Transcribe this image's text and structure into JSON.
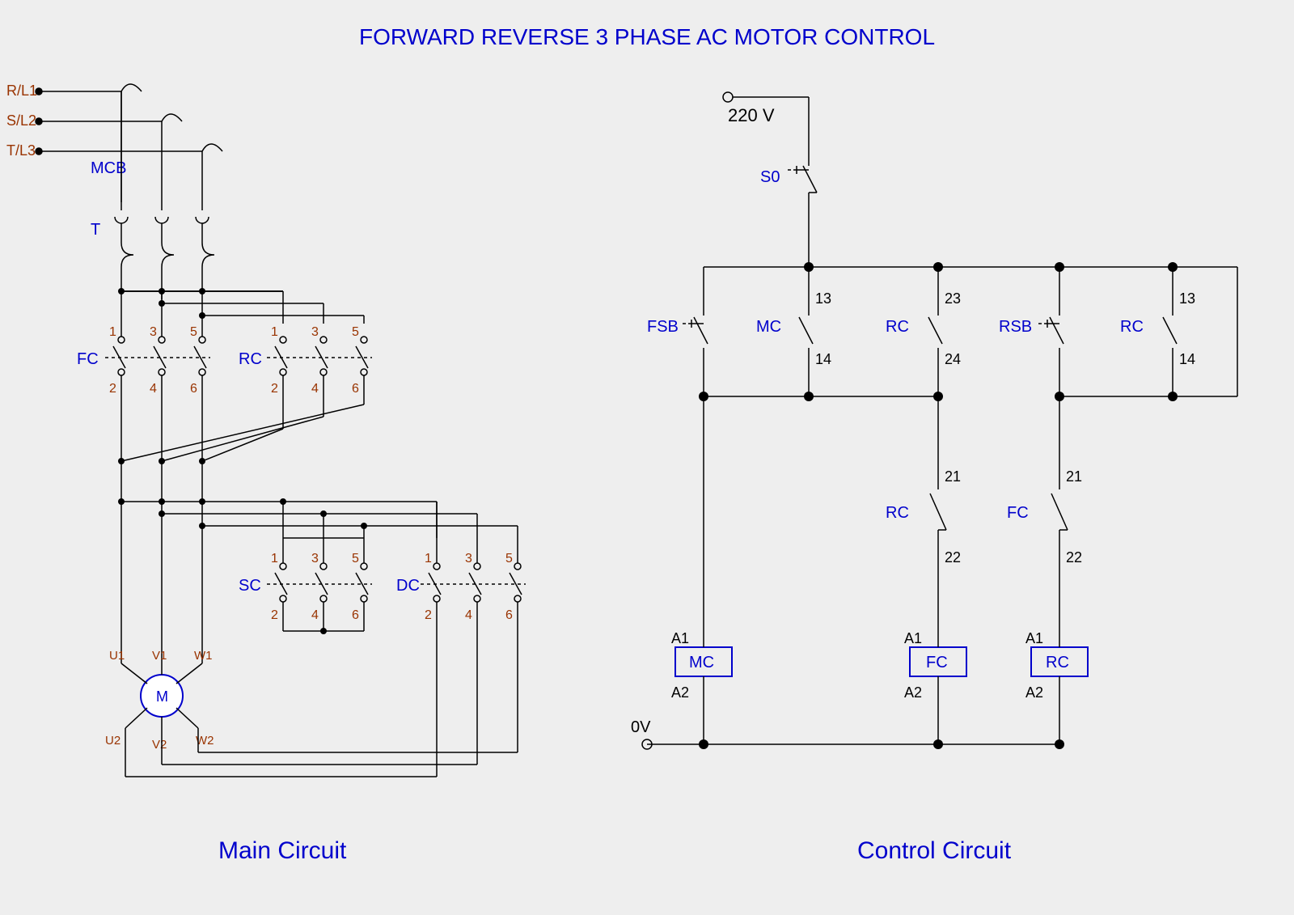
{
  "title": "FORWARD REVERSE 3 PHASE AC MOTOR CONTROL",
  "main_circuit_label": "Main Circuit",
  "control_circuit_label": "Control Circuit",
  "main": {
    "lines": {
      "l1": "R/L1",
      "l2": "S/L2",
      "l3": "T/L3"
    },
    "mcb": "MCB",
    "t": "T",
    "fc": "FC",
    "rc": "RC",
    "sc": "SC",
    "dc": "DC",
    "motor": "M",
    "motor_terms": {
      "u1": "U1",
      "v1": "V1",
      "w1": "W1",
      "u2": "U2",
      "v2": "V2",
      "w2": "W2"
    },
    "nums": {
      "n1": "1",
      "n2": "2",
      "n3": "3",
      "n4": "4",
      "n5": "5",
      "n6": "6"
    }
  },
  "control": {
    "v_top": "220 V",
    "v_bot": "0V",
    "s0": "S0",
    "fsb": "FSB",
    "rsb": "RSB",
    "mc": "MC",
    "rc": "RC",
    "fc": "FC",
    "a1": "A1",
    "a2": "A2",
    "c13": "13",
    "c14": "14",
    "c21": "21",
    "c22": "22",
    "c23": "23",
    "c24": "24"
  }
}
